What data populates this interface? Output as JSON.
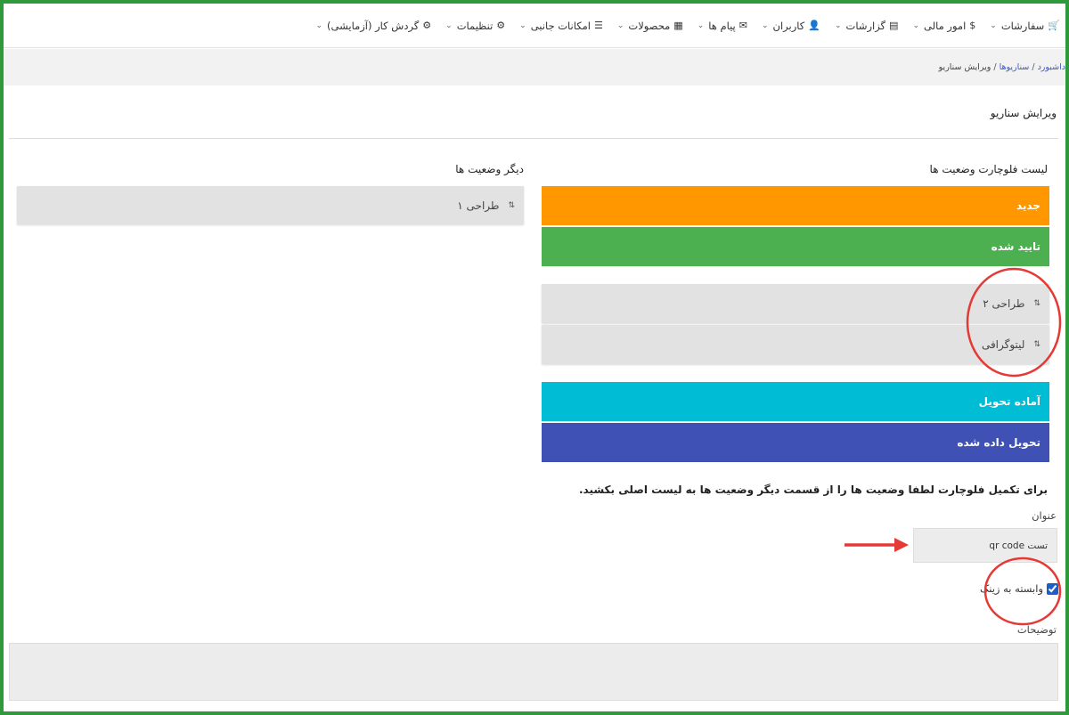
{
  "nav": {
    "items": [
      {
        "label": "سفارشات",
        "icon": "cart-icon",
        "glyph": "🛒"
      },
      {
        "label": "امور مالی",
        "icon": "dollar-icon",
        "glyph": "$"
      },
      {
        "label": "گزارشات",
        "icon": "report-icon",
        "glyph": "▤"
      },
      {
        "label": "کاربران",
        "icon": "user-icon",
        "glyph": "👤"
      },
      {
        "label": "پیام ها",
        "icon": "message-icon",
        "glyph": "✉"
      },
      {
        "label": "محصولات",
        "icon": "products-icon",
        "glyph": "▦"
      },
      {
        "label": "امکانات جانبی",
        "icon": "list-icon",
        "glyph": "☰"
      },
      {
        "label": "تنظیمات",
        "icon": "gear-icon",
        "glyph": "⚙"
      },
      {
        "label": "گردش کار (آزمایشی)",
        "icon": "workflow-icon",
        "glyph": "⚙"
      }
    ]
  },
  "breadcrumb": {
    "home": "داشبورد",
    "scenarios": "سناریوها",
    "current": "ویرایش سناریو",
    "separator": "/"
  },
  "page_title": "ویرایش سناریو",
  "flow_list": {
    "title": "لیست فلوچارت وضعیت ها",
    "items": [
      {
        "label": "جدید",
        "color": "#ff9800"
      },
      {
        "label": "تایید شده",
        "color": "#4caf50"
      },
      {
        "label": "طراحی ۲",
        "color": "#e2e2e2"
      },
      {
        "label": "لیتوگرافی",
        "color": "#e2e2e2"
      },
      {
        "label": "آماده تحویل",
        "color": "#00bcd4"
      },
      {
        "label": "تحویل داده شده",
        "color": "#3f51b5"
      }
    ]
  },
  "other_list": {
    "title": "دیگر وضعیت ها",
    "items": [
      {
        "label": "طراحی ۱"
      }
    ]
  },
  "hint_text": "برای تکمیل فلوچارت لطفا وضعیت ها را از قسمت دیگر وضعیت ها به لیست اصلی بکشید.",
  "form": {
    "title_label": "عنوان",
    "title_value": "تست qr code",
    "checkbox_label": "وابسته به زینک",
    "checkbox_checked": true,
    "desc_label": "توضیحات",
    "desc_value": ""
  },
  "colors": {
    "frame_border": "#2e9a3c",
    "annotation": "#e53935"
  }
}
